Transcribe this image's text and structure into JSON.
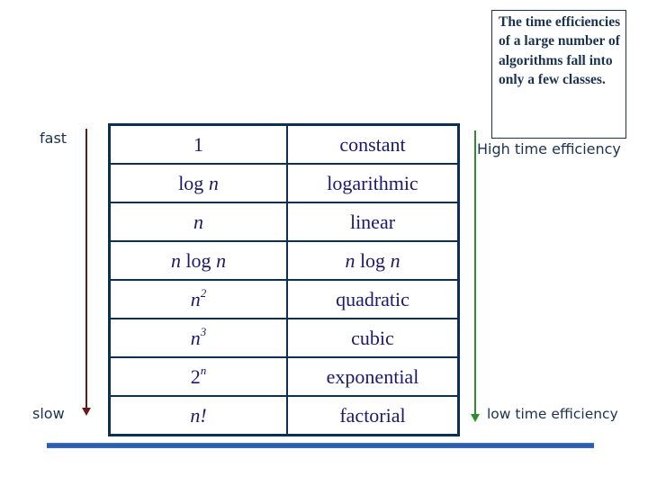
{
  "speed_scale": {
    "fast_label": "fast",
    "slow_label": "slow",
    "arrow_color": "#6b1a1a"
  },
  "efficiency_scale": {
    "high_label": "High time efficiency",
    "low_label": "low time efficiency",
    "arrow_color": "#2e8b2e"
  },
  "note": "The time efficiencies of a large number of algorithms fall into only a few classes.",
  "table": {
    "rows": [
      {
        "complexity": {
          "base": "1",
          "italic": false
        },
        "name": "constant"
      },
      {
        "complexity": {
          "prefix": "log ",
          "var": "n"
        },
        "name": "logarithmic"
      },
      {
        "complexity": {
          "var": "n"
        },
        "name": "linear"
      },
      {
        "complexity": {
          "var": "n",
          "suffix": " log ",
          "var2": "n"
        },
        "name_parts": {
          "var": "n",
          "suffix": " log ",
          "var2": "n"
        }
      },
      {
        "complexity": {
          "var": "n",
          "sup": "2"
        },
        "name": "quadratic"
      },
      {
        "complexity": {
          "var": "n",
          "sup": "3"
        },
        "name": "cubic"
      },
      {
        "complexity": {
          "base": "2",
          "sup": "n"
        },
        "name": "exponential"
      },
      {
        "complexity": {
          "var": "n!"
        },
        "name": "factorial"
      }
    ]
  }
}
